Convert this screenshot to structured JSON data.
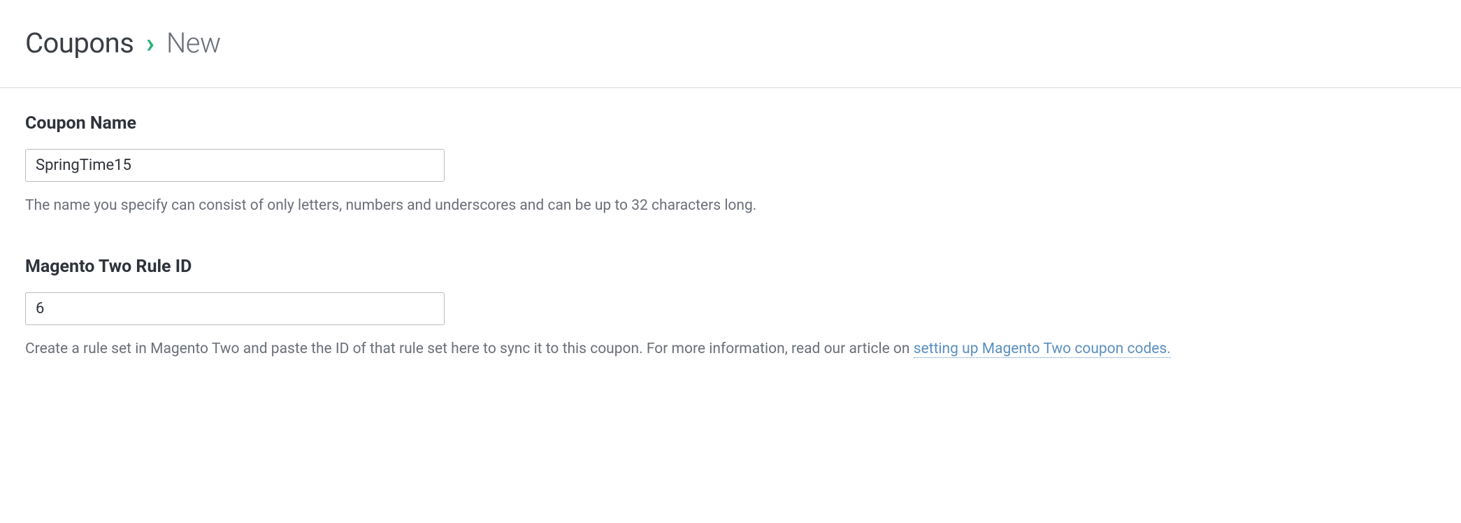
{
  "breadcrumb": {
    "root": "Coupons",
    "sep": "›",
    "current": "New"
  },
  "form": {
    "couponName": {
      "label": "Coupon Name",
      "value": "SpringTime15",
      "help": "The name you specify can consist of only letters, numbers and underscores and can be up to 32 characters long."
    },
    "ruleId": {
      "label": "Magento Two Rule ID",
      "value": "6",
      "helpPrefix": "Create a rule set in Magento Two and paste the ID of that rule set here to sync it to this coupon. For more information, read our article on ",
      "helpLink": "setting up Magento Two coupon codes."
    }
  }
}
